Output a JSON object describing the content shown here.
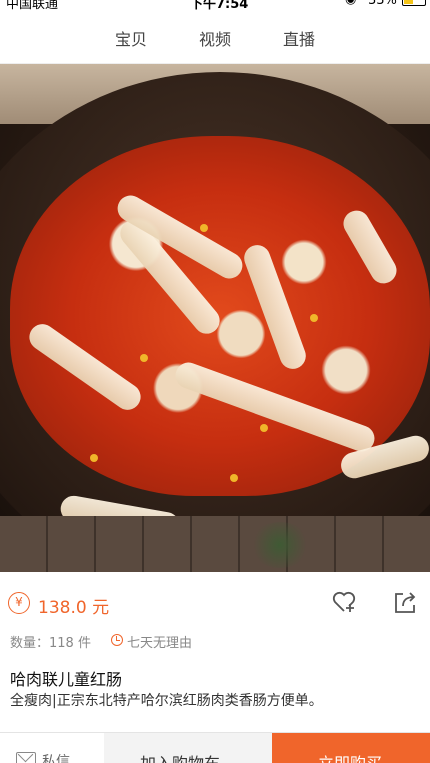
{
  "status_bar": {
    "carrier": "中国联通",
    "time": "下午7:54",
    "battery": "33%"
  },
  "tabs": [
    {
      "label": "宝贝"
    },
    {
      "label": "视频"
    },
    {
      "label": "直播"
    }
  ],
  "product": {
    "currency_symbol": "¥",
    "price": "138.0 元",
    "quantity": "数量：118 件",
    "return_policy": "七天无理由",
    "title": "哈肉联儿童红肠",
    "subtitle": "全瘦肉|正宗东北特产哈尔滨红肠肉类香肠方便单。"
  },
  "bottom_bar": {
    "message_label": "私信",
    "add_to_cart_label": "加入购物车",
    "buy_now_label": "立即购买"
  },
  "colors": {
    "accent": "#f0652b"
  }
}
